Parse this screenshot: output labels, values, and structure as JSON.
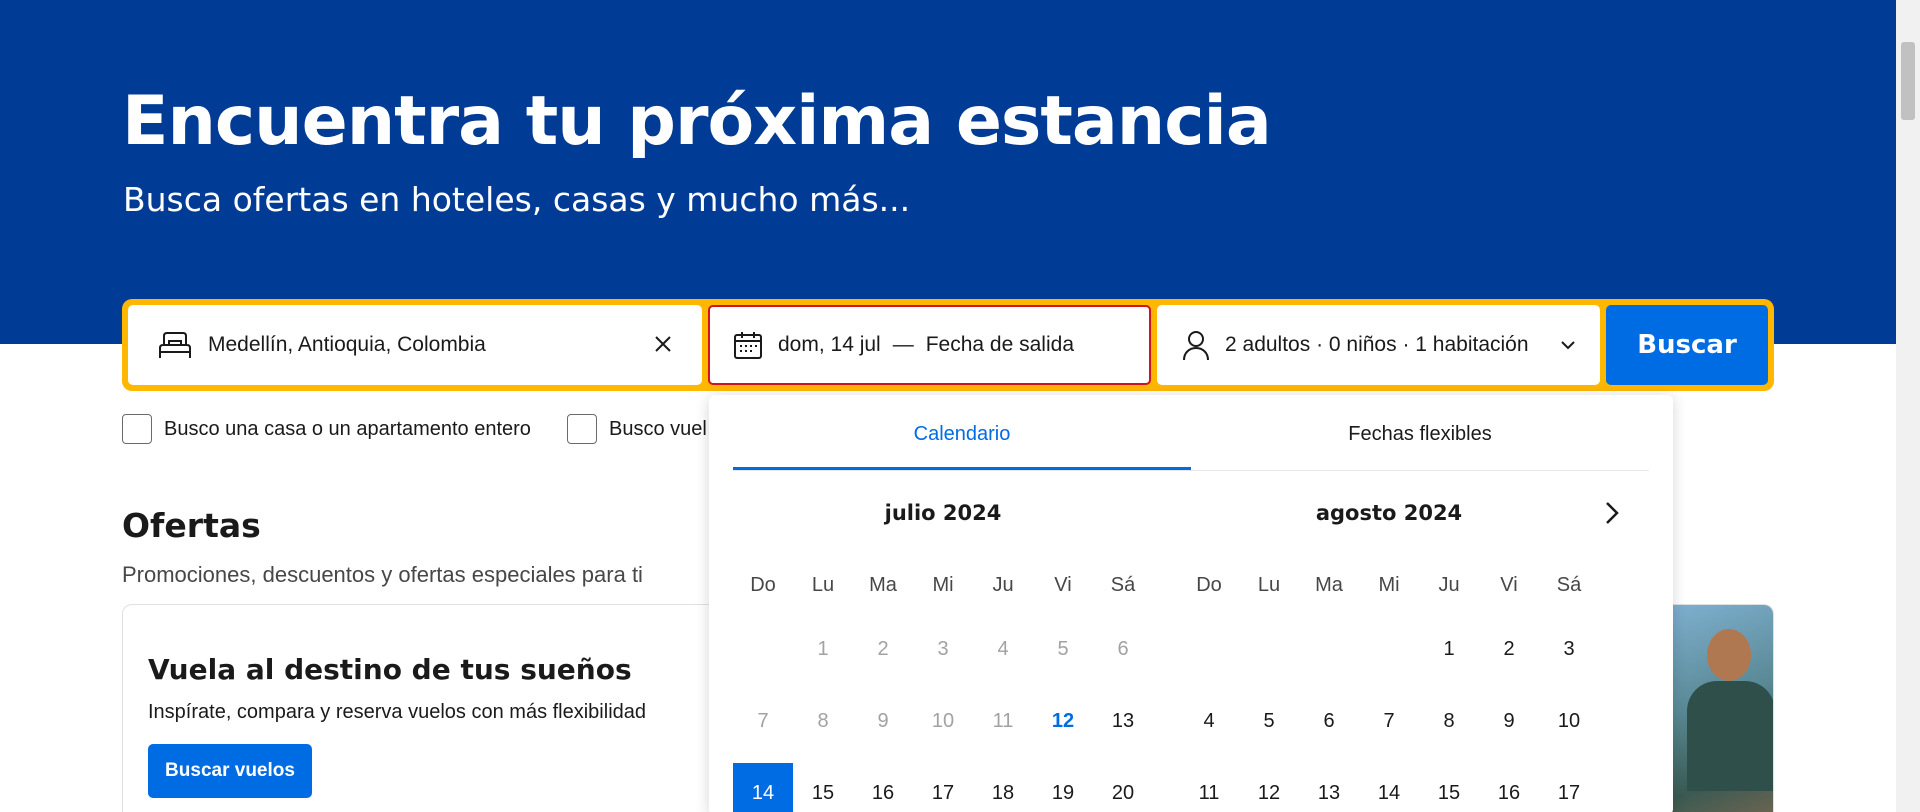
{
  "hero": {
    "title": "Encuentra tu próxima estancia",
    "subtitle": "Busca ofertas en hoteles, casas y mucho más..."
  },
  "search": {
    "destination": "Medellín, Antioquia, Colombia",
    "checkin": "dom, 14 jul",
    "separator": "—",
    "checkout_placeholder": "Fecha de salida",
    "guests": "2 adultos · 0 niños · 1 habitación",
    "button": "Buscar",
    "icons": {
      "destination": "bed-icon",
      "clear": "close-icon",
      "dates": "calendar-icon",
      "guests": "person-icon",
      "expand": "chevron-down-icon"
    },
    "accent": "#ffb700",
    "button_color": "#006ce4"
  },
  "filters": {
    "whole_home": "Busco una casa o un apartamento entero",
    "flights": "Busco vuel"
  },
  "offers": {
    "title": "Ofertas",
    "subtitle": "Promociones, descuentos y ofertas especiales para ti",
    "card": {
      "title": "Vuela al destino de tus sueños",
      "text": "Inspírate, compara y reserva vuelos con más flexibilidad",
      "button": "Buscar vuelos"
    }
  },
  "datepicker": {
    "tabs": [
      "Calendario",
      "Fechas flexibles"
    ],
    "active_tab": "Calendario",
    "weekdays": [
      "Do",
      "Lu",
      "Ma",
      "Mi",
      "Ju",
      "Vi",
      "Sá"
    ],
    "months": [
      {
        "title": "julio 2024",
        "leading_blanks": 1,
        "days": [
          "1",
          "2",
          "3",
          "4",
          "5",
          "6",
          "7",
          "8",
          "9",
          "10",
          "11",
          "12",
          "13",
          "14",
          "15",
          "16",
          "17",
          "18",
          "19",
          "20"
        ],
        "past_until": 11,
        "today": "12",
        "selected": "14"
      },
      {
        "title": "agosto 2024",
        "leading_blanks": 4,
        "days": [
          "1",
          "2",
          "3",
          "4",
          "5",
          "6",
          "7",
          "8",
          "9",
          "10",
          "11",
          "12",
          "13",
          "14",
          "15",
          "16",
          "17"
        ]
      }
    ],
    "next_icon": "chevron-right-icon"
  },
  "colors": {
    "hero_bg": "#003b95",
    "primary": "#006ce4",
    "highlight": "#ffb700"
  }
}
